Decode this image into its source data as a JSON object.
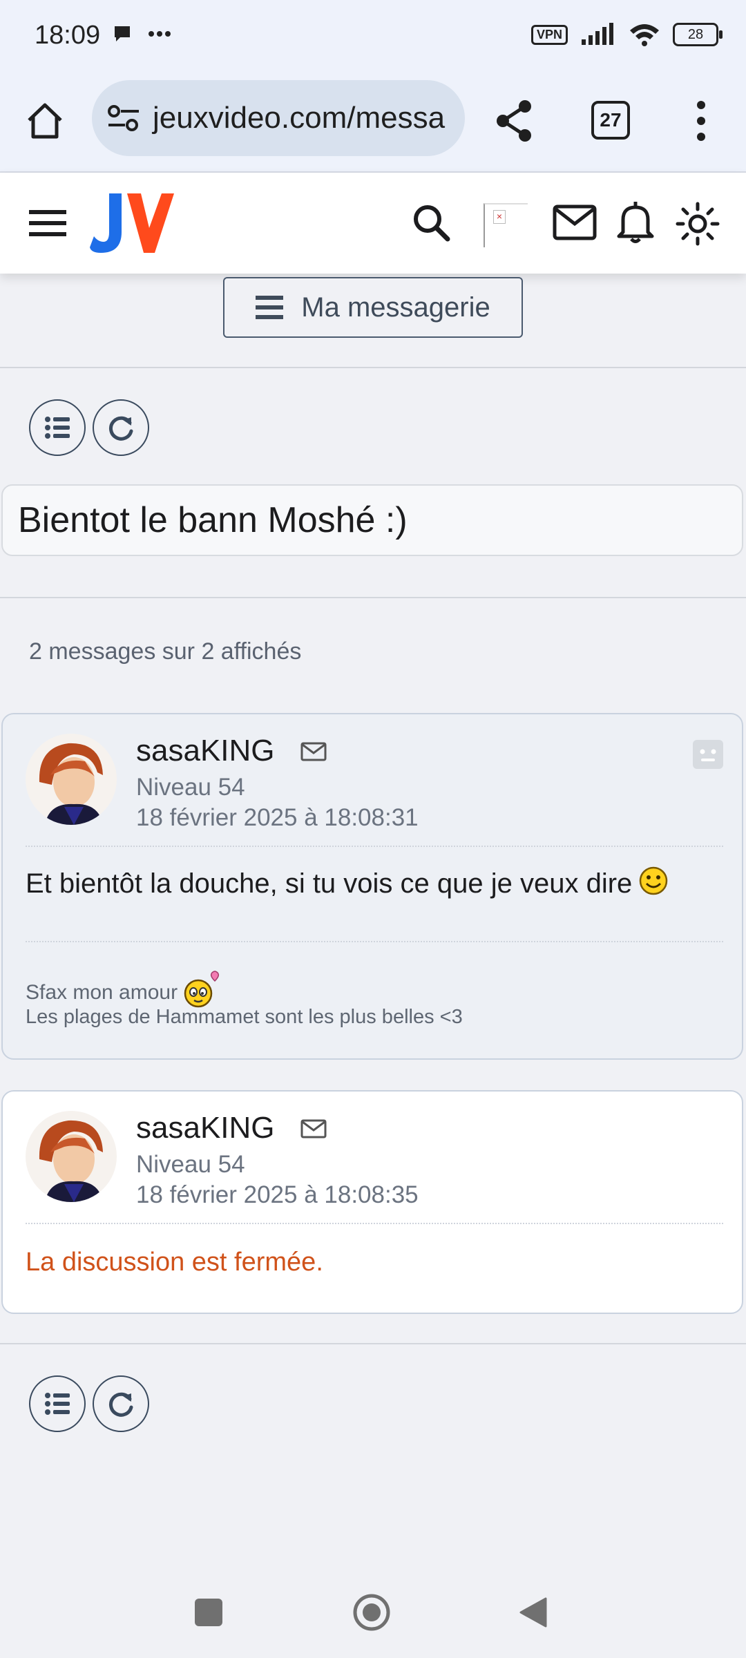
{
  "status_bar": {
    "time": "18:09",
    "vpn": "VPN",
    "battery": "28"
  },
  "browser": {
    "url": "jeuxvideo.com/messa",
    "tab_count": "27"
  },
  "site": {
    "logo_text": "JV",
    "logo_colors": {
      "j": "#1e6ee8",
      "v": "#ff4a1c"
    }
  },
  "messagerie_button": "Ma messagerie",
  "thread": {
    "title": "Bientot le bann Moshé :)",
    "count_text": "2 messages sur 2 affichés"
  },
  "posts": [
    {
      "author": "sasaKING",
      "level": "Niveau 54",
      "date": "18 février 2025 à 18:08:31",
      "body": "Et bientôt la douche, si tu vois ce que je veux dire",
      "signature_line1": "Sfax mon amour",
      "signature_line2": "Les plages de Hammamet sont les plus belles <3"
    },
    {
      "author": "sasaKING",
      "level": "Niveau 54",
      "date": "18 février 2025 à 18:08:35",
      "notice": "La discussion est fermée."
    }
  ],
  "colors": {
    "closed_notice": "#d0521a",
    "page_bg": "#f0f1f5"
  }
}
